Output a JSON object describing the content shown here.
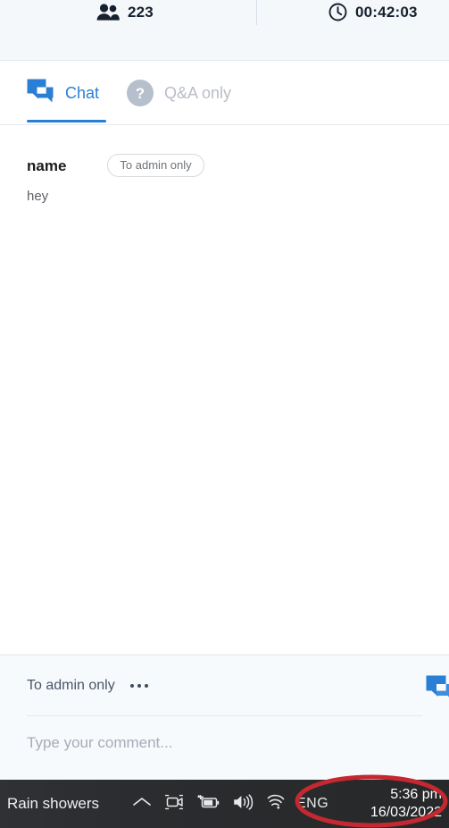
{
  "topbar": {
    "participants": {
      "icon": "people-icon",
      "count": "223"
    },
    "timer": {
      "icon": "clock-icon",
      "value": "00:42:03"
    }
  },
  "tabs": [
    {
      "id": "chat",
      "label": "Chat",
      "icon": "chat-bubble-icon",
      "active": true
    },
    {
      "id": "qa",
      "label": "Q&A only",
      "icon": "question-mark-icon",
      "active": false
    }
  ],
  "messages": [
    {
      "author": "name",
      "badge": "To admin only",
      "text": "hey"
    }
  ],
  "composer": {
    "target_label": "To admin only",
    "more_icon": "ellipsis-icon",
    "chat_icon": "chat-bubble-icon",
    "placeholder": "Type your comment...",
    "value": ""
  },
  "taskbar": {
    "weather": "Rain showers",
    "tray_icons": [
      "chevron-up-icon",
      "webcam-icon",
      "battery-charging-icon",
      "volume-icon",
      "wifi-icon"
    ],
    "language": "ENG",
    "time": "5:36 pm",
    "date": "16/03/2022"
  },
  "annotation": {
    "shape": "ellipse-highlight",
    "color": "#c42830",
    "target": "clock"
  },
  "colors": {
    "accent": "#2a7fd4",
    "topbar_bg": "#f5f8fb",
    "composer_bg": "#f7fafc",
    "taskbar_bg": "#2b2b2b",
    "annotation_red": "#c42830"
  }
}
